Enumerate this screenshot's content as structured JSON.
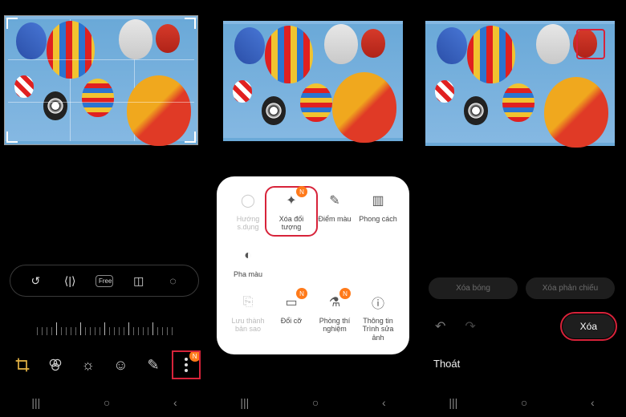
{
  "left": {
    "transform_tools": [
      "rotate",
      "flip",
      "free",
      "aspect",
      "perspective"
    ],
    "free_label": "Free",
    "edit_tools": {
      "crop": "crop-icon",
      "filter": "filter-icon",
      "brightness": "brightness-icon",
      "sticker": "sticker-icon",
      "draw": "draw-icon"
    },
    "more_badge": "N"
  },
  "popup": {
    "items": [
      {
        "key": "huong-su-dung",
        "label": "Hướng s.dụng",
        "badge": false,
        "dim": true,
        "highlight": false
      },
      {
        "key": "xoa-doi-tuong",
        "label": "Xóa đối tượng",
        "badge": true,
        "dim": false,
        "highlight": true
      },
      {
        "key": "diem-mau",
        "label": "Điểm màu",
        "badge": false,
        "dim": false,
        "highlight": false
      },
      {
        "key": "phong-cach",
        "label": "Phong cách",
        "badge": false,
        "dim": false,
        "highlight": false
      },
      {
        "key": "pha-mau",
        "label": "Pha màu",
        "badge": false,
        "dim": false,
        "highlight": false
      },
      {
        "key": "spacer",
        "label": "",
        "badge": false,
        "dim": true,
        "highlight": false
      },
      {
        "key": "spacer2",
        "label": "",
        "badge": false,
        "dim": true,
        "highlight": false
      },
      {
        "key": "spacer3",
        "label": "",
        "badge": false,
        "dim": true,
        "highlight": false
      },
      {
        "key": "luu-thanh-ban-sao",
        "label": "Lưu thành bản sao",
        "badge": false,
        "dim": true,
        "highlight": false
      },
      {
        "key": "doi-co",
        "label": "Đổi cỡ",
        "badge": true,
        "dim": false,
        "highlight": false
      },
      {
        "key": "phong-thi-nghiem",
        "label": "Phòng thí nghiệm",
        "badge": true,
        "dim": false,
        "highlight": false
      },
      {
        "key": "thong-tin",
        "label": "Thông tin Trình sửa ảnh",
        "badge": false,
        "dim": false,
        "highlight": false
      }
    ],
    "badge_text": "N"
  },
  "right": {
    "pill_shadow": "Xóa bóng",
    "pill_reflection": "Xóa phản chiếu",
    "erase_button": "Xóa",
    "exit_label": "Thoát"
  },
  "nav": {
    "recent": "|||",
    "home": "○",
    "back": "‹"
  }
}
